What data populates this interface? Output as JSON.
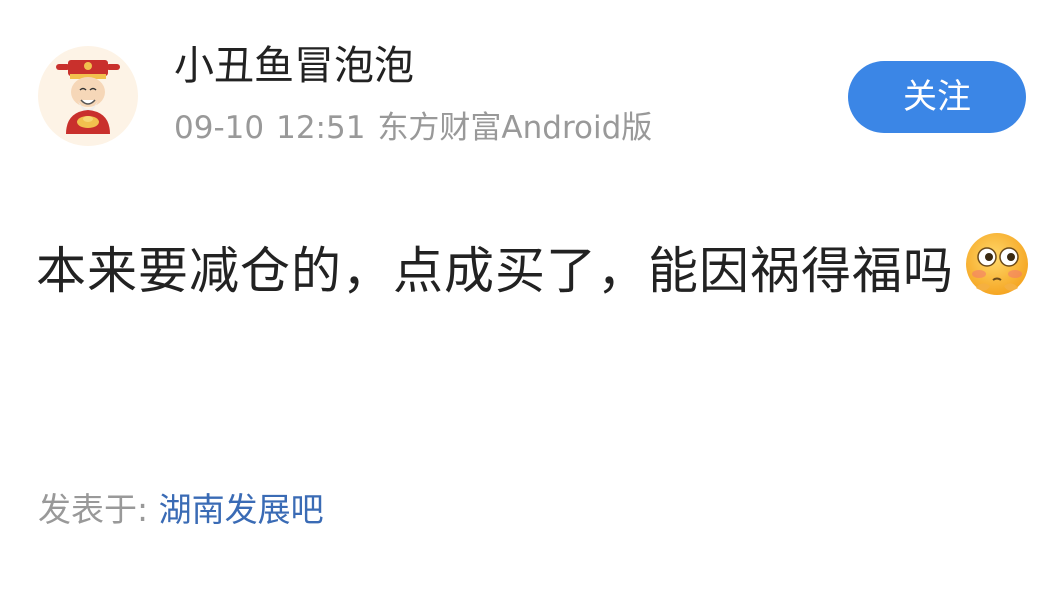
{
  "post": {
    "author": {
      "name": "小丑鱼冒泡泡",
      "avatar_icon": "caishen-avatar-icon"
    },
    "date": "09-10",
    "time": "12:51",
    "client": "东方财富Android版",
    "follow_label": "关注",
    "content_text": "本来要减仓的，点成买了，能因祸得福吗",
    "emoji_icon": "flushed-thinking-emoji",
    "source_label": "发表于:",
    "source_forum": "湖南发展吧"
  },
  "colors": {
    "accent": "#3b86e6",
    "link": "#3a6bb5",
    "meta_gray": "#999999",
    "text": "#222222"
  }
}
